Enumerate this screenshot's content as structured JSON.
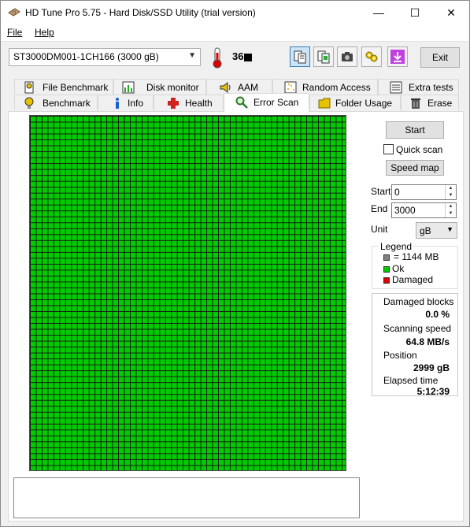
{
  "window": {
    "title": "HD Tune Pro 5.75 - Hard Disk/SSD Utility (trial version)",
    "controls": {
      "minimize": "—",
      "maximize": "☐",
      "close": "✕"
    }
  },
  "menu": {
    "file": "File",
    "help": "Help"
  },
  "toolbar": {
    "drive": "ST3000DM001-1CH166 (3000 gB)",
    "temperature": "36",
    "temperature_unit_glyph": "°C",
    "exit_label": "Exit",
    "buttons": [
      "copy-text-icon",
      "copy-screenshot-icon",
      "camera-icon",
      "options-icon",
      "save-arrow-icon"
    ]
  },
  "tabs": {
    "row1": [
      "File Benchmark",
      "Disk monitor",
      "AAM",
      "Random Access",
      "Extra tests"
    ],
    "row2": [
      "Benchmark",
      "Info",
      "Health",
      "Error Scan",
      "Folder Usage",
      "Erase"
    ],
    "selected": "Error Scan"
  },
  "scan": {
    "grid_columns": 54,
    "grid_rows": 60,
    "block_status": "Ok",
    "start_label": "Start",
    "quick_scan_label": "Quick scan",
    "quick_scan_checked": false,
    "speed_map_label": "Speed map",
    "start_field_label": "Start",
    "start_value": "0",
    "end_field_label": "End",
    "end_value": "3000",
    "unit_label": "Unit",
    "unit_value": "gB"
  },
  "legend": {
    "title": "Legend",
    "block_size": "= 1144 MB",
    "ok": "Ok",
    "damaged": "Damaged",
    "colors": {
      "block": "#808080",
      "ok": "#00cc00",
      "damaged": "#dd0000"
    }
  },
  "stats": {
    "damaged_blocks_label": "Damaged blocks",
    "damaged_blocks_value": "0.0 %",
    "scanning_speed_label": "Scanning speed",
    "scanning_speed_value": "64.8 MB/s",
    "position_label": "Position",
    "position_value": "2999 gB",
    "elapsed_label": "Elapsed time",
    "elapsed_value": "5:12:39"
  }
}
